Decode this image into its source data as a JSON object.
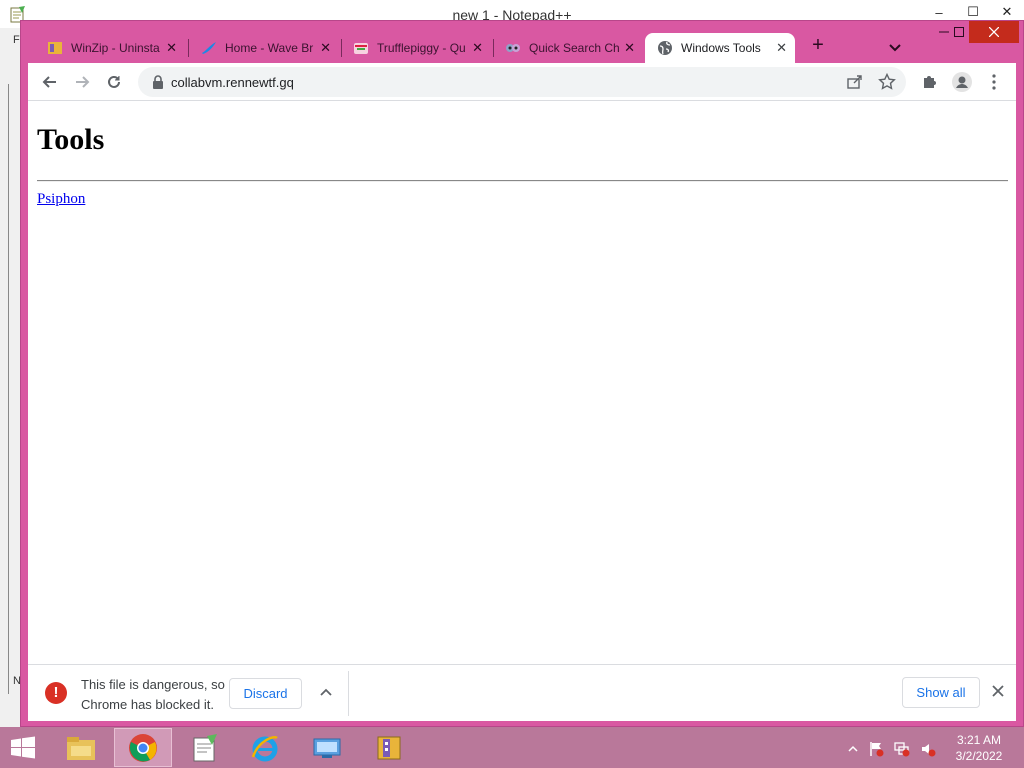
{
  "background_window": {
    "title": "new 1 - Notepad++",
    "controls": [
      "–",
      "☐",
      "✕"
    ],
    "side_letters": [
      "F",
      "N"
    ]
  },
  "browser": {
    "tabs": [
      {
        "title": "WinZip - Uninsta",
        "icon": "winzip-icon",
        "active": false
      },
      {
        "title": "Home - Wave Br",
        "icon": "wave-browser-icon",
        "active": false
      },
      {
        "title": "Trufflepiggy - Qu",
        "icon": "trufflepiggy-icon",
        "active": false
      },
      {
        "title": "Quick Search Ch",
        "icon": "quick-search-icon",
        "active": false
      },
      {
        "title": "Windows Tools",
        "icon": "globe-icon",
        "active": true
      }
    ],
    "new_tab_label": "+",
    "url": "collabvm.rennewtf.gq",
    "theme_color": "#d958a2"
  },
  "page": {
    "heading": "Tools",
    "link": "Psiphon"
  },
  "download_bar": {
    "message": "This file is dangerous, so Chrome has blocked it.",
    "discard_label": "Discard",
    "show_all_label": "Show all"
  },
  "taskbar": {
    "pinned": [
      "file-explorer-icon",
      "chrome-icon",
      "notepad-plus-plus-icon",
      "internet-explorer-icon",
      "control-panel-icon",
      "winzip-icon"
    ],
    "time": "3:21 AM",
    "date": "3/2/2022"
  }
}
